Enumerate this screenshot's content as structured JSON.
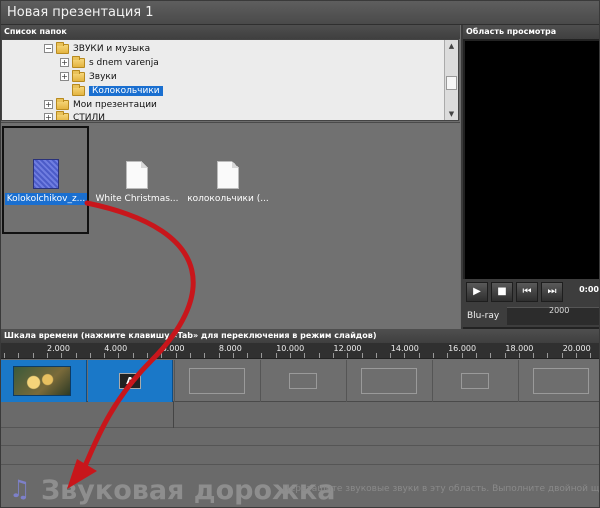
{
  "window": {
    "title": "Новая презентация 1"
  },
  "folders_panel": {
    "header": "Список папок",
    "items": [
      {
        "label": "ЗВУКИ и музыка",
        "expander": "⊟",
        "selected": false
      },
      {
        "label": "s dnem varenja",
        "expander": "⊞",
        "selected": false
      },
      {
        "label": "Звуки",
        "expander": "⊞",
        "selected": false
      },
      {
        "label": "Колокольчики",
        "expander": "",
        "selected": true
      },
      {
        "label": "Мои презентации",
        "expander": "⊞",
        "selected": false
      },
      {
        "label": "СТИЛИ",
        "expander": "⊞",
        "selected": false
      }
    ]
  },
  "files": [
    {
      "label": "Kolokolchikov_z...",
      "icon": "audio-file-icon",
      "selected": true
    },
    {
      "label": "White Christmas...",
      "icon": "document-icon",
      "selected": false
    },
    {
      "label": "колокольчики  (...",
      "icon": "document-icon",
      "selected": false
    }
  ],
  "preview_panel": {
    "header": "Область просмотра",
    "time": "0:00",
    "format": "Blu-ray",
    "mini_ruler_label": "2000",
    "buttons": [
      "play",
      "stop",
      "previous",
      "next"
    ]
  },
  "timeline": {
    "header": "Шкала времени (нажмите клавишу «Tab» для переключения в режим слайдов)",
    "ruler_labels": [
      "2.000",
      "4.000",
      "6.000",
      "8.000",
      "10.000",
      "12.000",
      "14.000",
      "16.000",
      "18.000",
      "20.000"
    ],
    "text_clip_label": "A"
  },
  "audio_track": {
    "title": "Звуковая дорожка",
    "hint": "Перетащите звуковые звуки в эту область. Выполните двойной щелчок"
  },
  "colors": {
    "selection": "#1a6fd0",
    "clip": "#1a78c8",
    "arrow": "#c8161b"
  }
}
